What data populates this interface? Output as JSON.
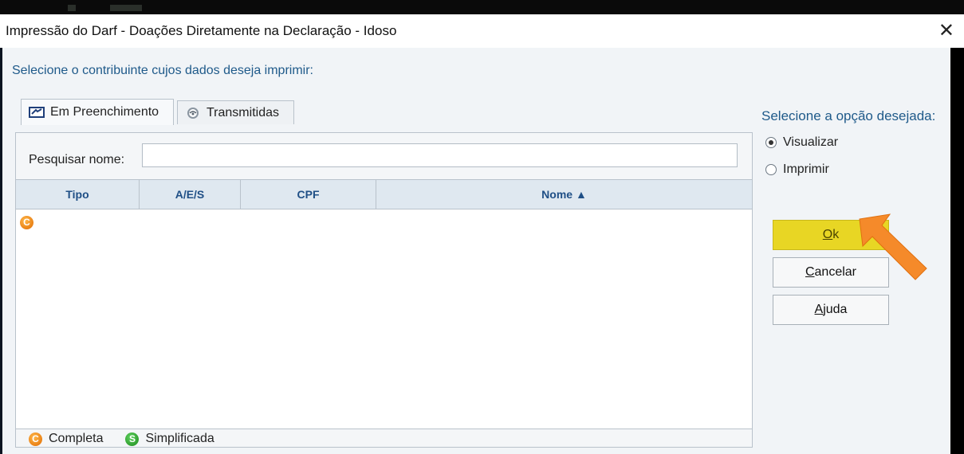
{
  "window": {
    "title": "Impressão do Darf - Doações Diretamente na Declaração - Idoso",
    "close_glyph": "✕"
  },
  "prompt": "Selecione o contribuinte cujos dados deseja imprimir:",
  "tabs": [
    {
      "label": "Em Preenchimento",
      "icon": "form-icon",
      "active": true
    },
    {
      "label": "Transmitidas",
      "icon": "transmit-icon",
      "active": false
    }
  ],
  "search": {
    "label": "Pesquisar nome:",
    "value": "",
    "placeholder": ""
  },
  "table": {
    "columns": [
      "Tipo",
      "A/E/S",
      "CPF",
      "Nome ▲"
    ],
    "rows": [
      {
        "tipo_icon": "completa-badge-icon"
      }
    ]
  },
  "legend": [
    {
      "badge": "C",
      "label": "Completa",
      "color": "#e06a00"
    },
    {
      "badge": "S",
      "label": "Simplificada",
      "color": "#1c8a1c"
    }
  ],
  "options": {
    "title": "Selecione a opção desejada:",
    "items": [
      {
        "label": "Visualizar",
        "checked": true
      },
      {
        "label": "Imprimir",
        "checked": false
      }
    ]
  },
  "buttons": {
    "ok": {
      "mnemonic": "O",
      "rest": "k",
      "color": "#e8d624"
    },
    "cancel": {
      "mnemonic": "C",
      "rest": "ancelar"
    },
    "help": {
      "mnemonic": "A",
      "rest": "juda"
    }
  },
  "colors": {
    "accent": "#1f5a8a",
    "header_text": "#1f4f86",
    "pointer_arrow": "#f58a2a"
  }
}
